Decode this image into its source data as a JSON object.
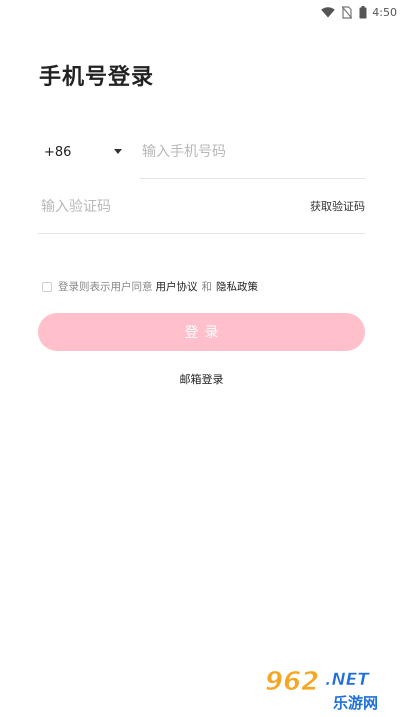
{
  "status_bar": {
    "time": "4:50",
    "icons": [
      "wifi-icon",
      "no-sim-icon",
      "battery-icon"
    ]
  },
  "title": "手机号登录",
  "phone": {
    "country_code": "+86",
    "placeholder": "输入手机号码",
    "value": ""
  },
  "code": {
    "placeholder": "输入验证码",
    "value": "",
    "get_code_label": "获取验证码"
  },
  "agreement": {
    "checked": false,
    "prefix": "登录则表示用户同意",
    "user_agreement": "用户协议",
    "and": "和",
    "privacy_policy": "隐私政策"
  },
  "login_button": {
    "label": "登录"
  },
  "email_login": {
    "label": "邮箱登录"
  },
  "watermark": {
    "number": "962",
    "suffix": ".NET",
    "site": "乐游网"
  },
  "colors": {
    "login_button_bg": "#ffc0cb",
    "watermark_orange": "#f5a623",
    "watermark_blue": "#1e6fd9"
  }
}
